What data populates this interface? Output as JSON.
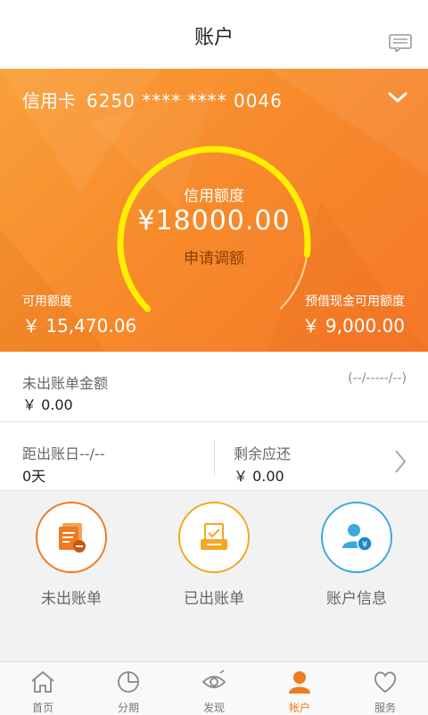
{
  "header": {
    "title": "账户",
    "message_icon": "message-icon"
  },
  "card": {
    "label": "信用卡",
    "number": "6250 **** **** 0046",
    "dropdown_icon": "chevron-down-icon",
    "gauge_label": "信用额度",
    "credit_limit": "¥18000.00",
    "apply_label": "申请调额",
    "gauge_fill_fraction": 0.86,
    "available_label": "可用额度",
    "available_value": "￥ 15,470.06",
    "cash_label": "预借现金可用额度",
    "cash_value": "￥ 9,000.00",
    "colors": {
      "gauge": "#ffef00",
      "orange": "#f78b2b"
    }
  },
  "unbilled": {
    "label": "未出账单金额",
    "value": "￥ 0.00",
    "date": "(--/-----/--)"
  },
  "billing": {
    "days_label": "距出账日--/--",
    "days_value": "0天",
    "remaining_label": "剩余应还",
    "remaining_value": "￥ 0.00"
  },
  "actions": [
    {
      "label": "未出账单",
      "icon": "unbilled-statement-icon",
      "color": "#f07a1e"
    },
    {
      "label": "已出账单",
      "icon": "billed-statement-icon",
      "color": "#f5a623"
    },
    {
      "label": "账户信息",
      "icon": "account-info-icon",
      "color": "#39a9e0"
    }
  ],
  "tabs": [
    {
      "label": "首页",
      "icon": "home-icon",
      "active": false
    },
    {
      "label": "分期",
      "icon": "installment-icon",
      "active": false
    },
    {
      "label": "发现",
      "icon": "discover-icon",
      "active": false
    },
    {
      "label": "帐户",
      "icon": "account-icon",
      "active": true
    },
    {
      "label": "服务",
      "icon": "service-icon",
      "active": false
    }
  ]
}
